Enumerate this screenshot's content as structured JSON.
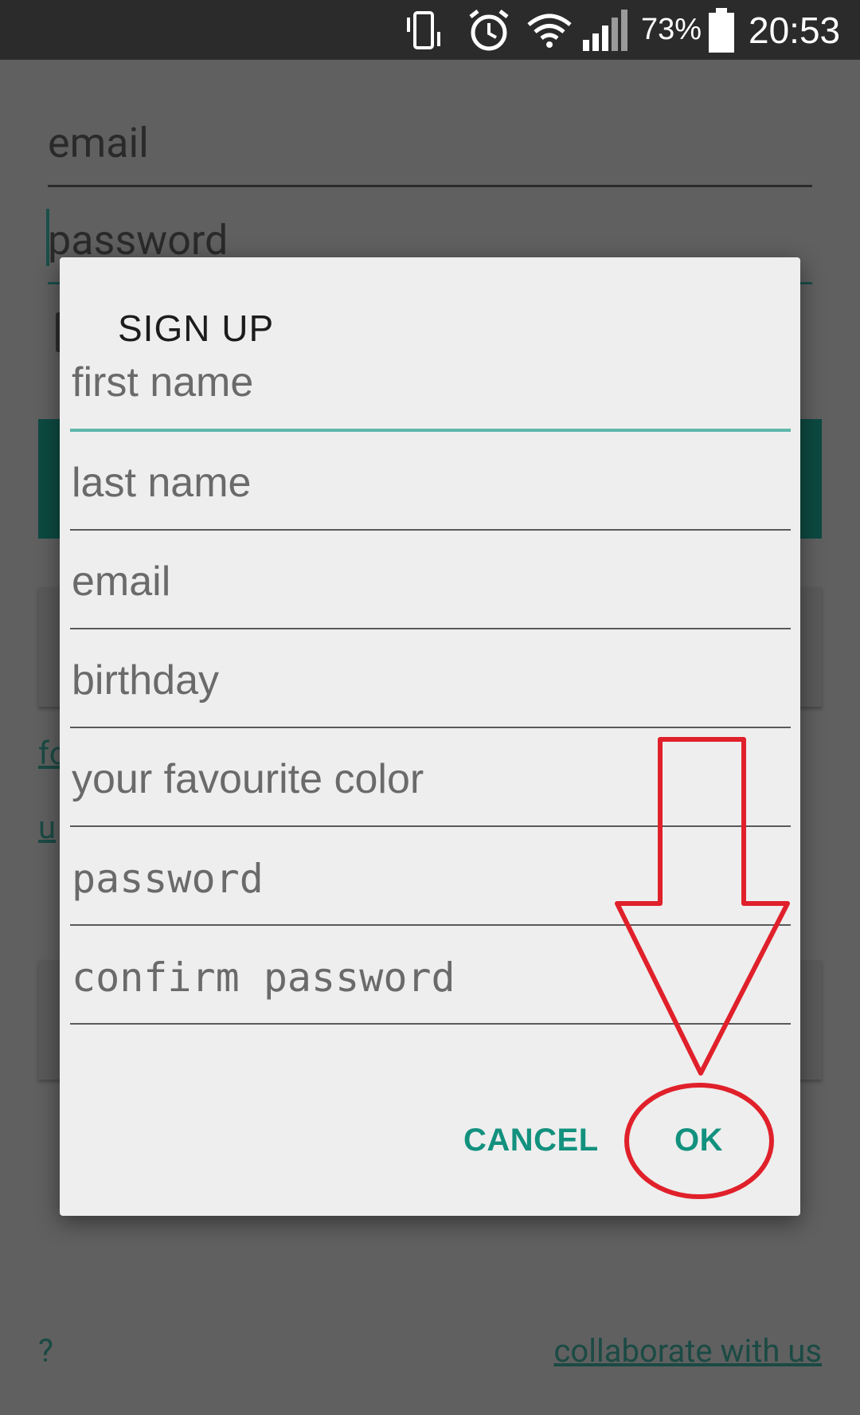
{
  "status_bar": {
    "battery_percent": "73%",
    "time": "20:53",
    "icons": [
      "vibrate-icon",
      "alarm-icon",
      "wifi-icon",
      "signal-icon",
      "battery-icon"
    ]
  },
  "background": {
    "email_placeholder": "email",
    "password_placeholder": "password",
    "link_fo": "fo",
    "link_u": "u",
    "help_link": "?",
    "collaborate_link": "collaborate with us"
  },
  "dialog": {
    "title": "SIGN UP",
    "fields": {
      "first_name": "first name",
      "last_name": "last name",
      "email": "email",
      "birthday": "birthday",
      "favourite_color": "your favourite color",
      "password": "password",
      "confirm_password": "confirm password"
    },
    "buttons": {
      "cancel": "CANCEL",
      "ok": "OK"
    }
  },
  "colors": {
    "accent": "#12917e",
    "annotation": "#e0202a"
  }
}
